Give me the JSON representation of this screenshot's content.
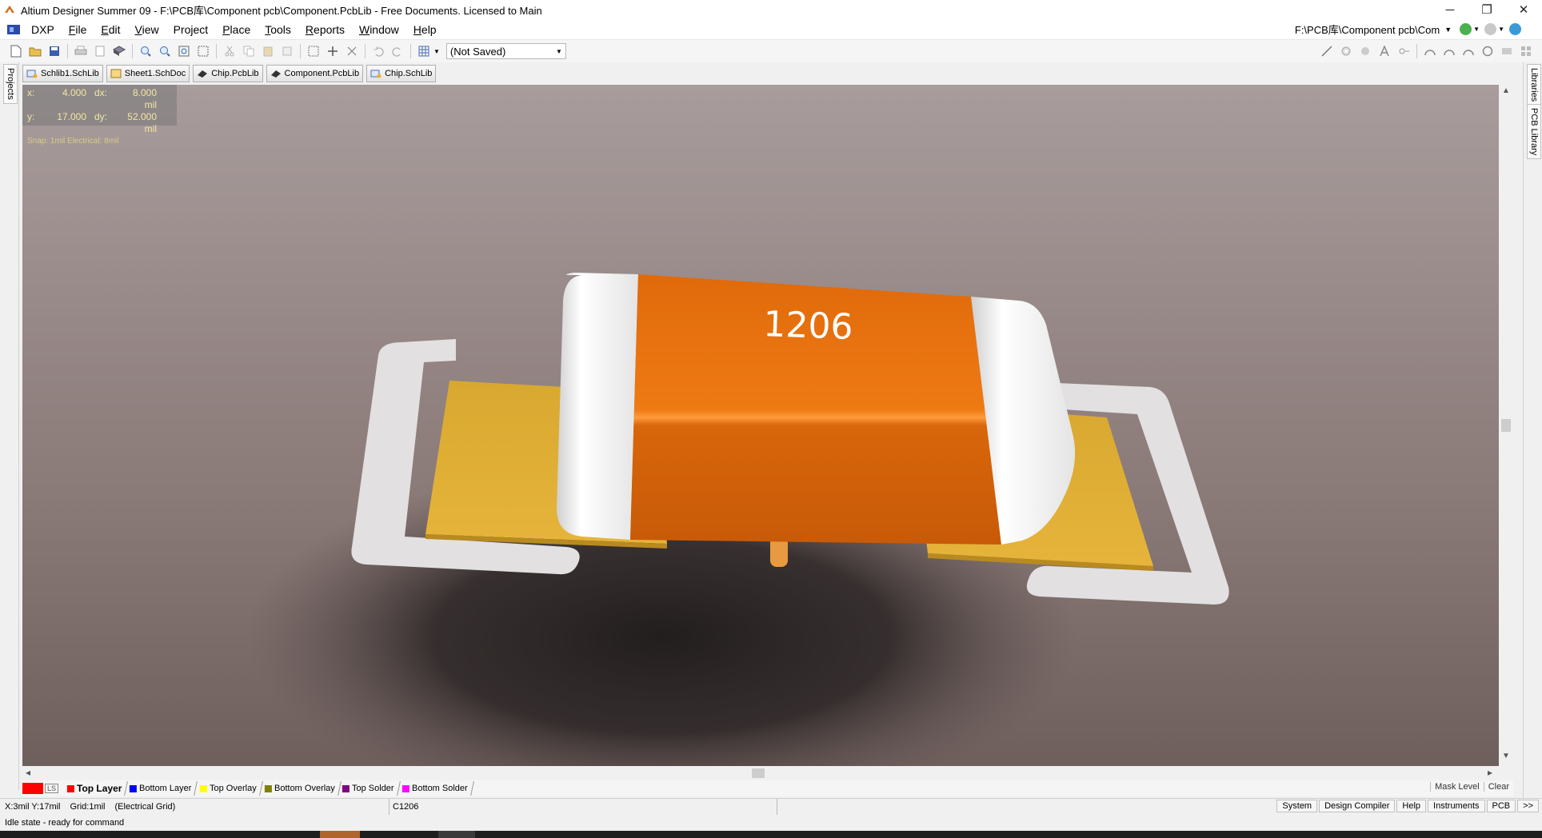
{
  "window": {
    "title": "Altium Designer Summer 09 - F:\\PCB库\\Component pcb\\Component.PcbLib - Free Documents. Licensed to Main",
    "minimize": "─",
    "restore": "❐",
    "close": "✕"
  },
  "menu": {
    "dxp": "DXP",
    "items": [
      {
        "u": "F",
        "rest": "ile"
      },
      {
        "u": "E",
        "rest": "dit"
      },
      {
        "u": "V",
        "rest": "iew"
      },
      {
        "u": "",
        "rest": "Project"
      },
      {
        "u": "P",
        "rest": "lace"
      },
      {
        "u": "T",
        "rest": "ools"
      },
      {
        "u": "R",
        "rest": "eports"
      },
      {
        "u": "W",
        "rest": "indow"
      },
      {
        "u": "H",
        "rest": "elp"
      }
    ],
    "path": "F:\\PCB库\\Component pcb\\Com"
  },
  "toolbar": {
    "variant_select": "(Not Saved)"
  },
  "doc_tabs": [
    {
      "label": "Schlib1.SchLib",
      "icon": "schlib-icon",
      "color": "#4a70b8"
    },
    {
      "label": "Sheet1.SchDoc",
      "icon": "schdoc-icon",
      "color": "#d8a020"
    },
    {
      "label": "Chip.PcbLib",
      "icon": "pcblib-icon",
      "color": "#333333"
    },
    {
      "label": "Component.PcbLib",
      "icon": "pcblib-icon",
      "color": "#333333"
    },
    {
      "label": "Chip.SchLib",
      "icon": "schlib-icon",
      "color": "#4a70b8"
    }
  ],
  "side_panels": {
    "left": "Projects",
    "right_top": "Libraries",
    "right_bottom": "PCB Library"
  },
  "hud": {
    "x_label": "x:",
    "x_value": "4.000",
    "dx_label": "dx:",
    "dx_value": "8.000 mil",
    "y_label": "y:",
    "y_value": "17.000",
    "dy_label": "dy:",
    "dy_value": "52.000 mil",
    "snap": "Snap: 1mil Electrical: 8mil"
  },
  "component": {
    "marking": "1206"
  },
  "layers": {
    "ls": "LS",
    "tabs": [
      {
        "label": "Top Layer",
        "color": "#ff0000",
        "active": true
      },
      {
        "label": "Bottom Layer",
        "color": "#0000ff",
        "active": false
      },
      {
        "label": "Top Overlay",
        "color": "#ffff00",
        "active": false
      },
      {
        "label": "Bottom Overlay",
        "color": "#808000",
        "active": false
      },
      {
        "label": "Top Solder",
        "color": "#800080",
        "active": false
      },
      {
        "label": "Bottom Solder",
        "color": "#ff00ff",
        "active": false
      }
    ],
    "mask_level": "Mask Level",
    "clear": "Clear"
  },
  "status": {
    "coords": "X:3mil Y:17mil",
    "grid": "Grid:1mil",
    "grid_type": "(Electrical Grid)",
    "component": "C1206",
    "panels": [
      "System",
      "Design Compiler",
      "Help",
      "Instruments",
      "PCB",
      ">>"
    ],
    "idle": "Idle state - ready for command"
  }
}
